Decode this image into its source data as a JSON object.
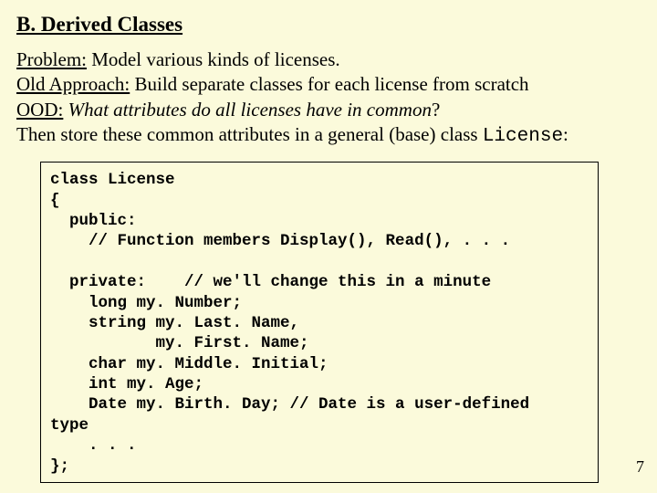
{
  "heading": "B. Derived Classes",
  "line1_label": "Problem:",
  "line1_text": "  Model various kinds of licenses.",
  "line2_label": "Old Approach:",
  "line2_text": "  Build separate classes for each license from scratch",
  "line3_label": "OOD:",
  "line3_text_italic": " What attributes do all licenses have in common",
  "line3_qmark": "?",
  "line4_a": "Then store these common attributes in a general (base) class ",
  "line4_code": "License",
  "line4_b": ":",
  "code": "class License\n{\n  public:\n    // Function members Display(), Read(), . . .\n\n  private:    // we'll change this in a minute\n    long my. Number;\n    string my. Last. Name,\n           my. First. Name;\n    char my. Middle. Initial;\n    int my. Age;\n    Date my. Birth. Day; // Date is a user-defined\ntype\n    . . .\n};",
  "page_number": "7"
}
